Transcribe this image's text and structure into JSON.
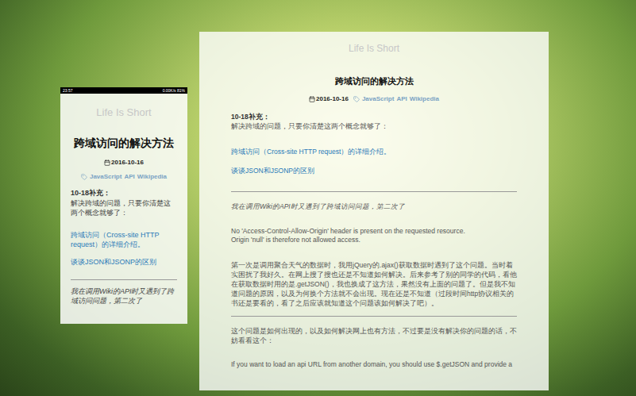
{
  "phone": {
    "status_bar": {
      "time": "23:57",
      "right": "0.00K/s 81%"
    },
    "site_title": "Life Is Short",
    "post": {
      "title": "跨域访问的解决方法",
      "date": "2016-10-16",
      "tags": [
        "JavaScript",
        "API",
        "Wikipedia"
      ],
      "update_label": "10-18补充：",
      "update_text": "解决跨域的问题，只要你清楚这两个概念就够了：",
      "links": [
        "跨域访问（Cross-site HTTP request）的详细介绍。",
        "谈谈JSON和JSONP的区别"
      ],
      "quote": "我在调用Wiki的API时又遇到了跨域访问问题，第二次了"
    }
  },
  "desktop": {
    "site_title": "Life Is Short",
    "post": {
      "title": "跨域访问的解决方法",
      "date": "2016-10-16",
      "tags": [
        "JavaScript",
        "API",
        "Wikipedia"
      ],
      "update_label": "10-18补充：",
      "update_text": "解决跨域的问题，只要你清楚这两个概念就够了：",
      "links": [
        "跨域访问（Cross-site HTTP request）的详细介绍。",
        "谈谈JSON和JSONP的区别"
      ],
      "quote": "我在调用Wiki的API时又遇到了跨域访问问题，第二次了",
      "error_lines": [
        "No 'Access-Control-Allow-Origin' header is present on the requested resource.",
        "Origin 'null' is therefore not allowed access."
      ],
      "paragraph": "第一次是调用聚合天气的数据时，我用jQuery的.ajax()获取数据时遇到了这个问题。当时着实困扰了我好久。在网上搜了搜也还是不知道如何解决。后来参考了别的同学的代码，看他在获取数据时用的是.getJSON()，我也换成了这方法，果然没有上面的问题了。但是我不知道问题的原因，以及为何换个方法就不会出现。现在还是不知道（过段时间http协议相关的书还是要看的，看了之后应该就知道这个问题该如何解决了吧）。",
      "paragraph2": "这个问题是如何出现的，以及如何解决网上也有方法，不过要是没有解决你的问题的话，不妨看看这个：",
      "paragraph3": "If you want to load an api URL from another domain, you should use $.getJSON and provide a"
    }
  }
}
